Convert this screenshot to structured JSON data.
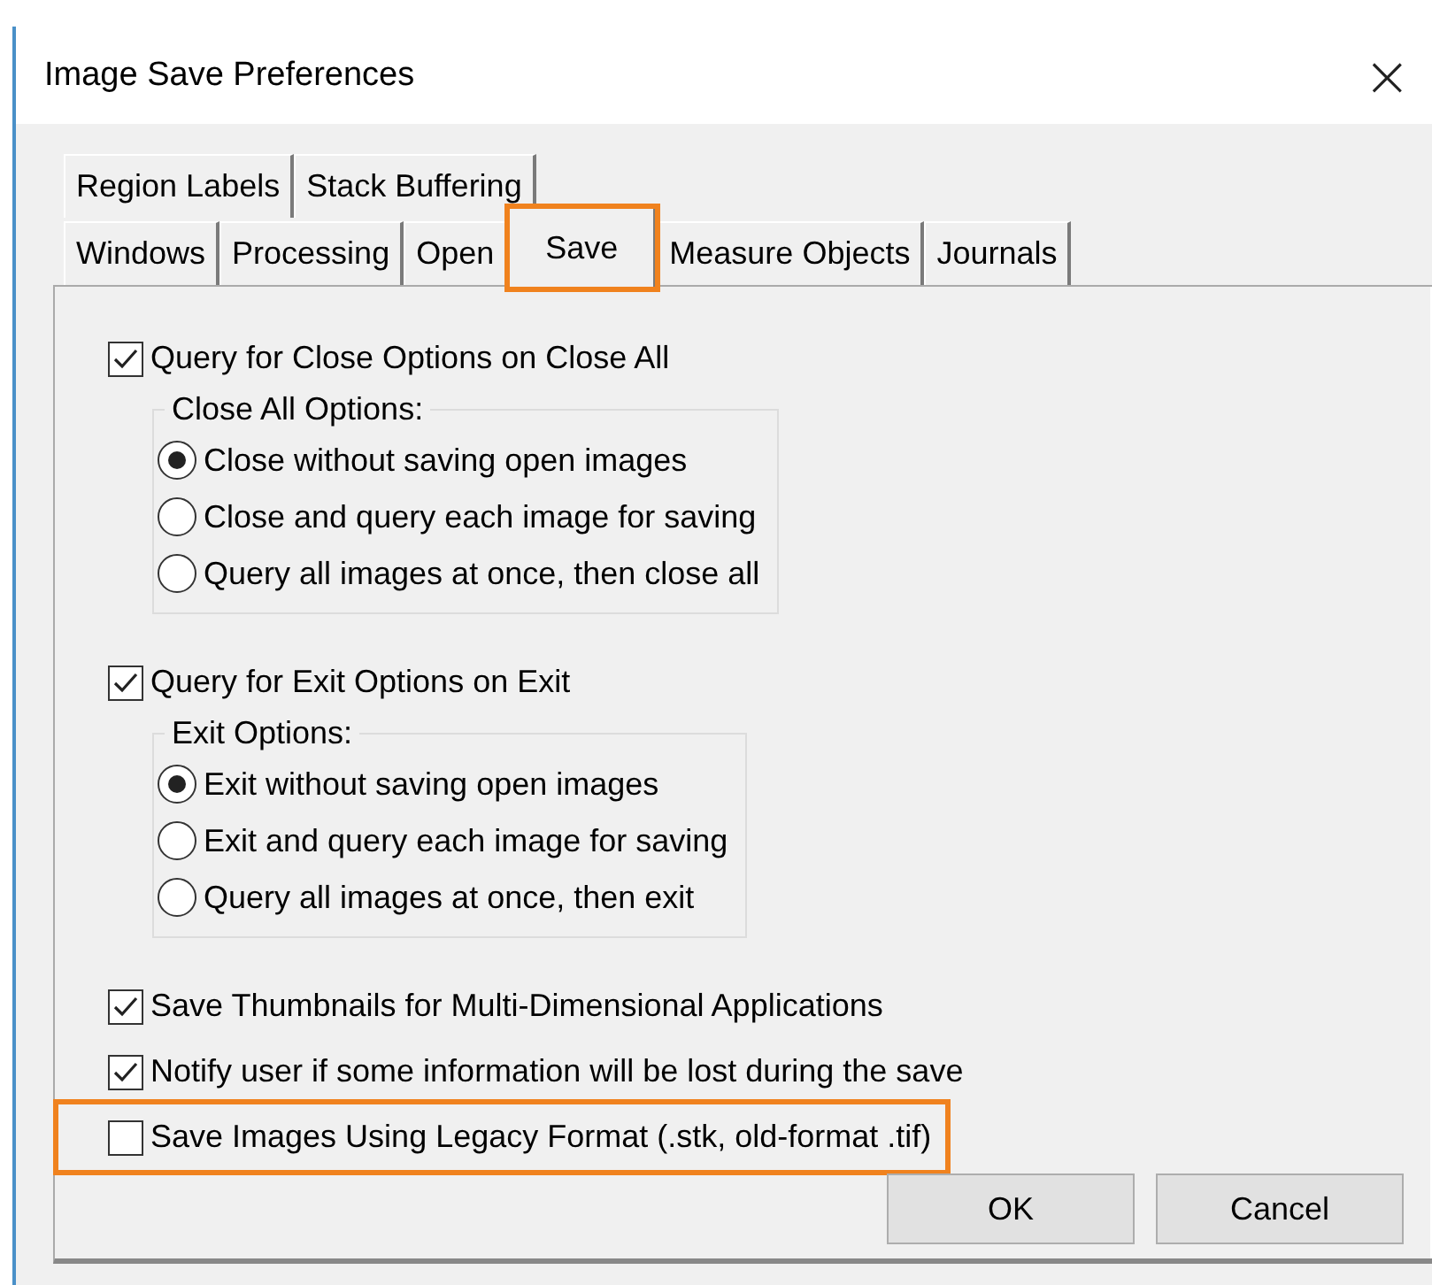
{
  "window": {
    "title": "Image Save Preferences",
    "close": "×"
  },
  "tab_rows": [
    [
      {
        "label": "Region Labels",
        "selected": false,
        "highlighted": false
      },
      {
        "label": "Stack Buffering",
        "selected": false,
        "highlighted": false
      }
    ],
    [
      {
        "label": "Windows",
        "selected": false,
        "highlighted": false
      },
      {
        "label": "Processing",
        "selected": false,
        "highlighted": false
      },
      {
        "label": "Open",
        "selected": false,
        "highlighted": false
      },
      {
        "label": "Save",
        "selected": true,
        "highlighted": true
      },
      {
        "label": "Measure Objects",
        "selected": false,
        "highlighted": false
      },
      {
        "label": "Journals",
        "selected": false,
        "highlighted": false
      }
    ]
  ],
  "sections": [
    {
      "checkbox": {
        "label": "Query for Close Options on Close All",
        "checked": true
      },
      "group": {
        "title": "Close All Options:",
        "options": [
          {
            "label": "Close without saving open images",
            "selected": true
          },
          {
            "label": "Close and query each image for saving",
            "selected": false
          },
          {
            "label": "Query all images at once, then close all",
            "selected": false
          }
        ]
      }
    },
    {
      "checkbox": {
        "label": "Query for Exit Options on Exit",
        "checked": true
      },
      "group": {
        "title": "Exit Options:",
        "options": [
          {
            "label": "Exit without saving open images",
            "selected": true
          },
          {
            "label": "Exit and query each image for saving",
            "selected": false
          },
          {
            "label": "Query all images at once, then exit",
            "selected": false
          }
        ]
      }
    }
  ],
  "options": [
    {
      "label": "Save Thumbnails for Multi-Dimensional Applications",
      "checked": true,
      "highlighted": false
    },
    {
      "label": "Notify user if some information will be lost during the save",
      "checked": true,
      "highlighted": false
    },
    {
      "label": "Save Images Using Legacy Format (.stk, old-format .tif)",
      "checked": false,
      "highlighted": true
    }
  ],
  "buttons": [
    "OK",
    "Cancel"
  ]
}
